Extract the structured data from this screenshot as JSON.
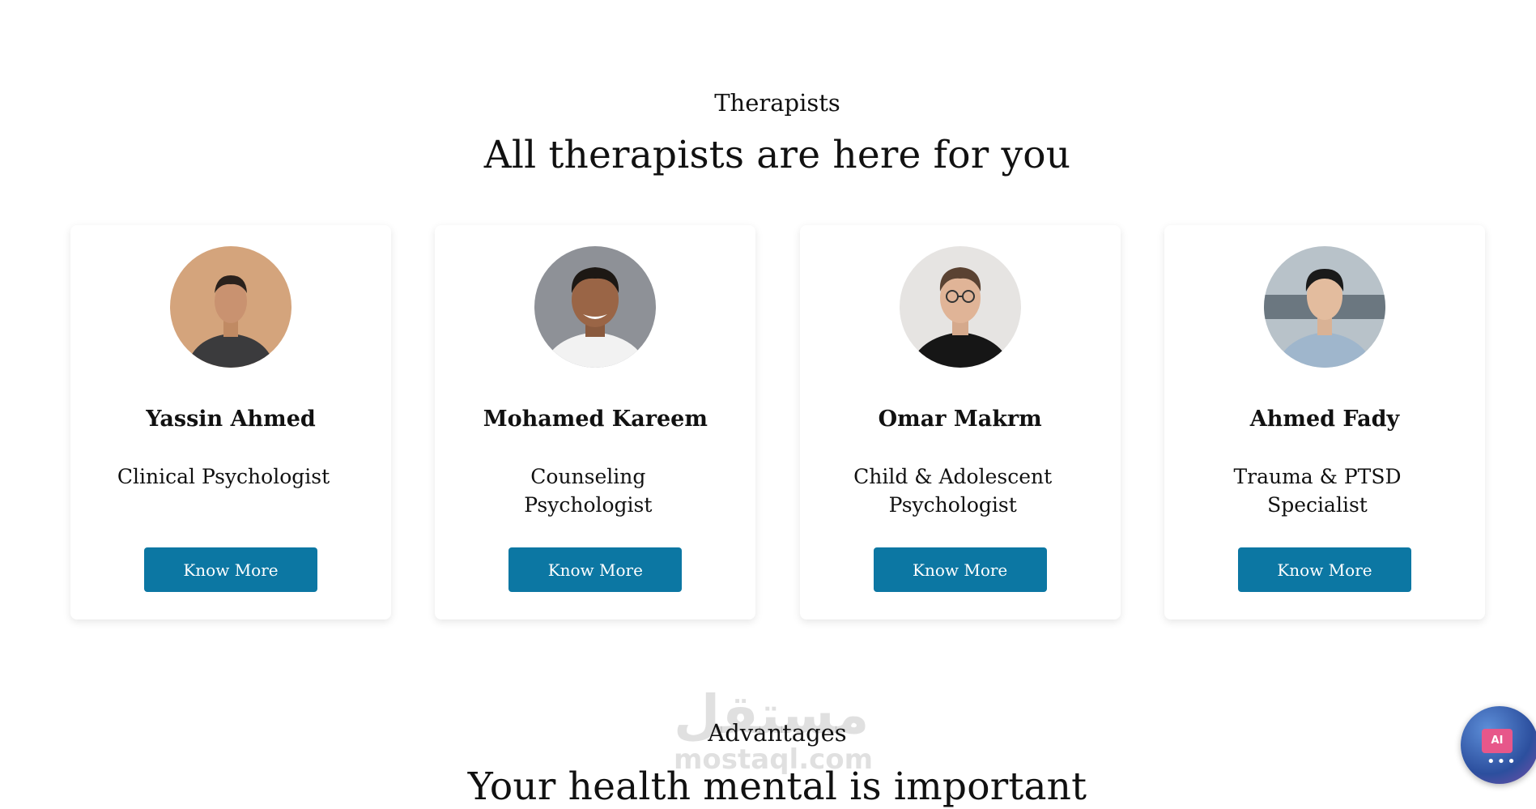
{
  "therapists_section": {
    "eyebrow": "Therapists",
    "title": "All therapists are here for you",
    "cards": [
      {
        "name": "Yassin Ahmed",
        "role": "Clinical Psychologist",
        "button": "Know More"
      },
      {
        "name": "Mohamed Kareem",
        "role": "Counseling Psychologist",
        "button": "Know More"
      },
      {
        "name": "Omar Makrm",
        "role": "Child & Adolescent Psychologist",
        "button": "Know More"
      },
      {
        "name": "Ahmed Fady",
        "role": "Trauma & PTSD Specialist",
        "button": "Know More"
      }
    ]
  },
  "advantages_section": {
    "eyebrow": "Advantages",
    "title": "Your health mental is important"
  },
  "watermark": {
    "arabic": "مستقل",
    "latin": "mostaql.com"
  },
  "ai_assistant": {
    "label": "AI",
    "icon": "ai-chip-icon"
  },
  "colors": {
    "button_bg": "#0c77a3",
    "button_text": "#ffffff",
    "text": "#111111"
  }
}
